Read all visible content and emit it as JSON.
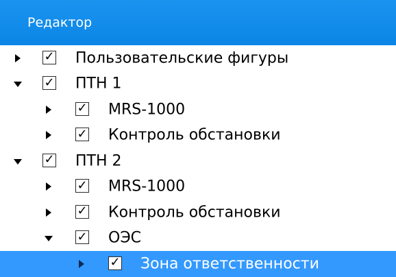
{
  "panel": {
    "title": "Редактор"
  },
  "tree": {
    "items": [
      {
        "label": "Пользовательские фигуры",
        "expanded": false,
        "checked": true
      },
      {
        "label": "ПТН 1",
        "expanded": true,
        "checked": true
      },
      {
        "label": "MRS-1000",
        "expanded": false,
        "checked": true
      },
      {
        "label": "Контроль обстановки",
        "expanded": false,
        "checked": true
      },
      {
        "label": "ПТН 2",
        "expanded": true,
        "checked": true
      },
      {
        "label": "MRS-1000",
        "expanded": false,
        "checked": true
      },
      {
        "label": "Контроль обстановки",
        "expanded": false,
        "checked": true
      },
      {
        "label": "ОЭС",
        "expanded": true,
        "checked": true
      },
      {
        "label": "Зона ответственности",
        "expanded": false,
        "checked": true,
        "selected": true
      }
    ],
    "check_glyph": "✓"
  },
  "colors": {
    "header": "#1a93ef",
    "selection": "#3399ff"
  }
}
